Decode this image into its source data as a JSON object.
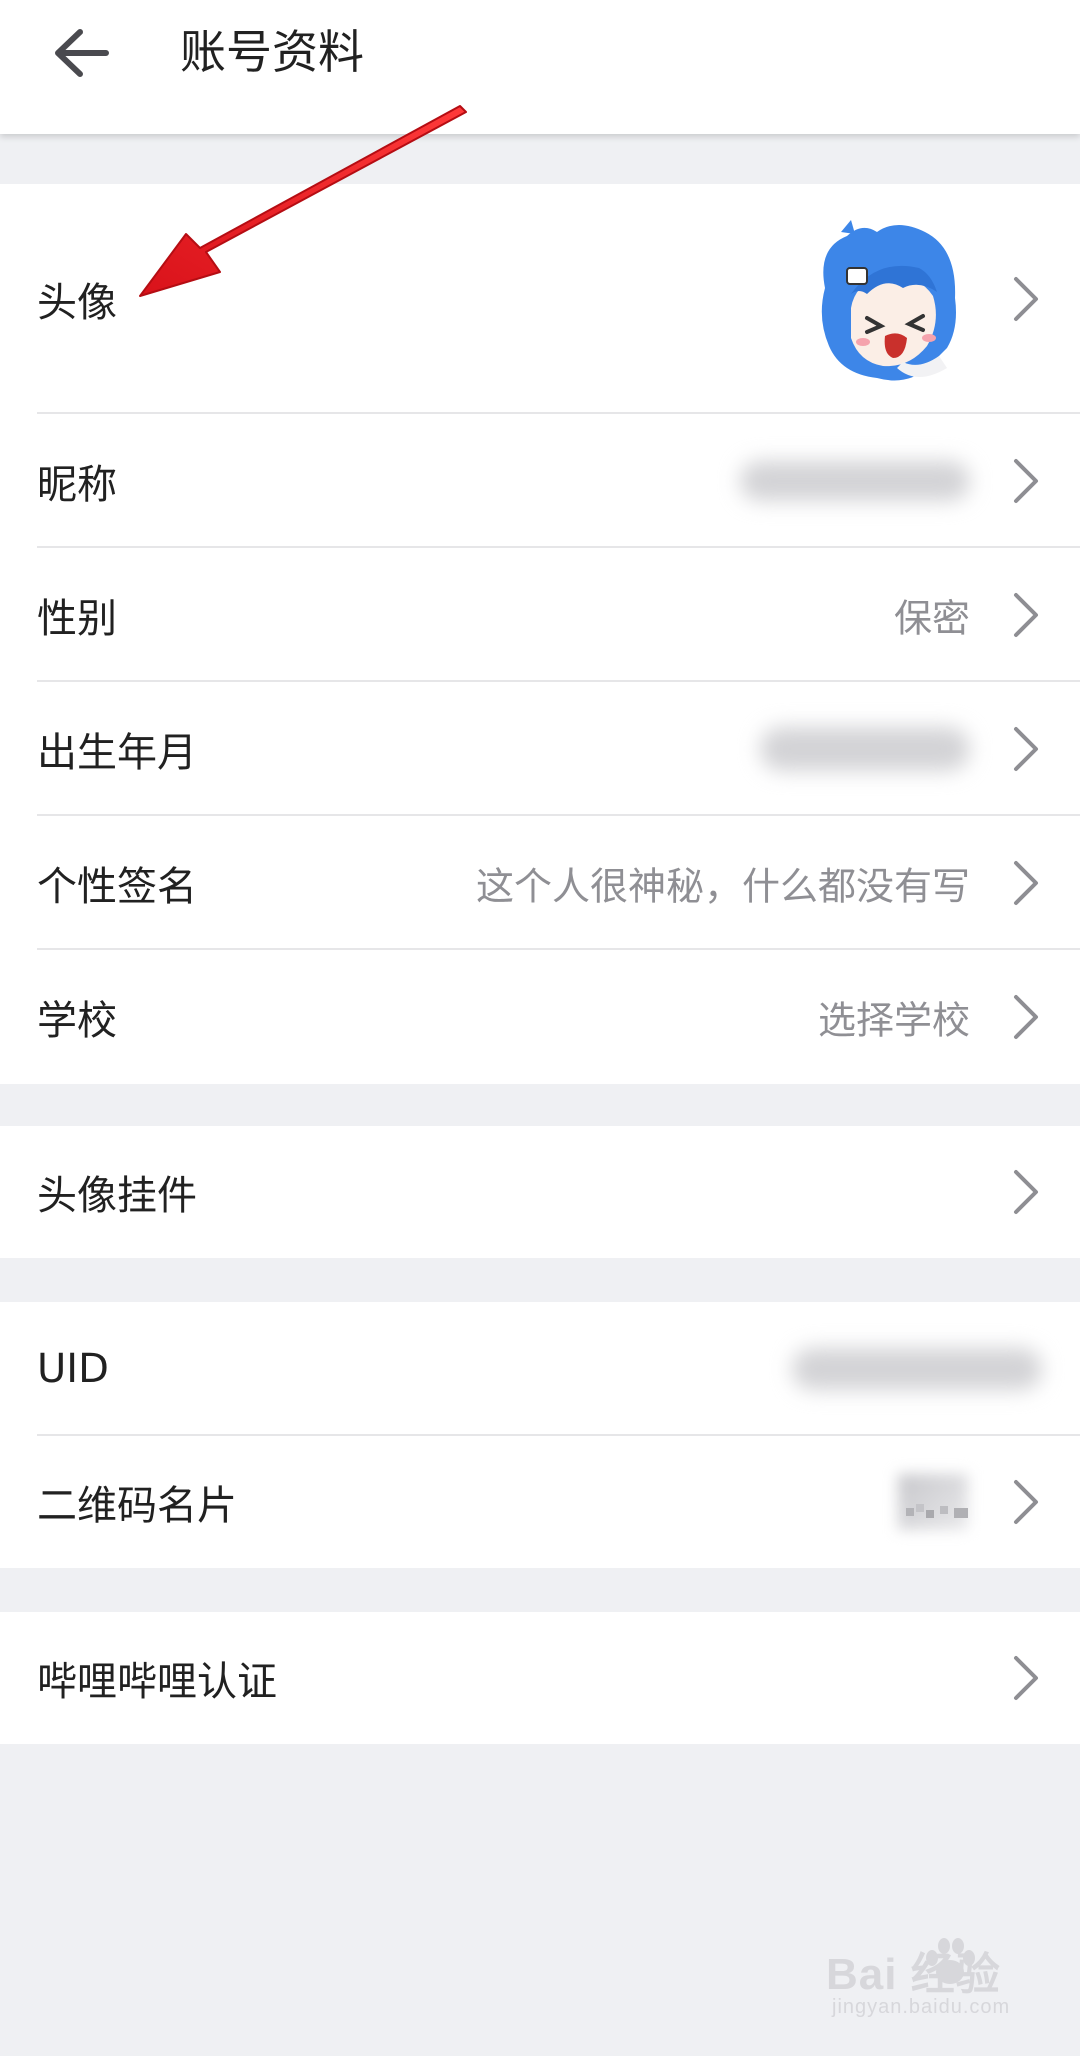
{
  "header": {
    "title": "账号资料"
  },
  "profile_group": {
    "avatar": {
      "label": "头像"
    },
    "nickname": {
      "label": "昵称"
    },
    "gender": {
      "label": "性别",
      "value": "保密"
    },
    "birthday": {
      "label": "出生年月"
    },
    "signature": {
      "label": "个性签名",
      "value": "这个人很神秘，什么都没有写"
    },
    "school": {
      "label": "学校",
      "value": "选择学校"
    }
  },
  "pendant": {
    "label": "头像挂件"
  },
  "id_group": {
    "uid": {
      "label": "UID"
    },
    "qrcode": {
      "label": "二维码名片"
    }
  },
  "certification": {
    "label": "哔哩哔哩认证"
  },
  "watermark": {
    "brand": "Bai  经验",
    "url": "jingyan.baidu.com"
  },
  "colors": {
    "background": "#eff0f3",
    "card": "#ffffff",
    "text_primary": "#212121",
    "text_secondary": "#8f8f94",
    "annotation_arrow": "#e8181d",
    "avatar_hair": "#3d86e8"
  },
  "icons": [
    "back-arrow-icon",
    "chevron-right-icon",
    "red-annotation-arrow"
  ]
}
